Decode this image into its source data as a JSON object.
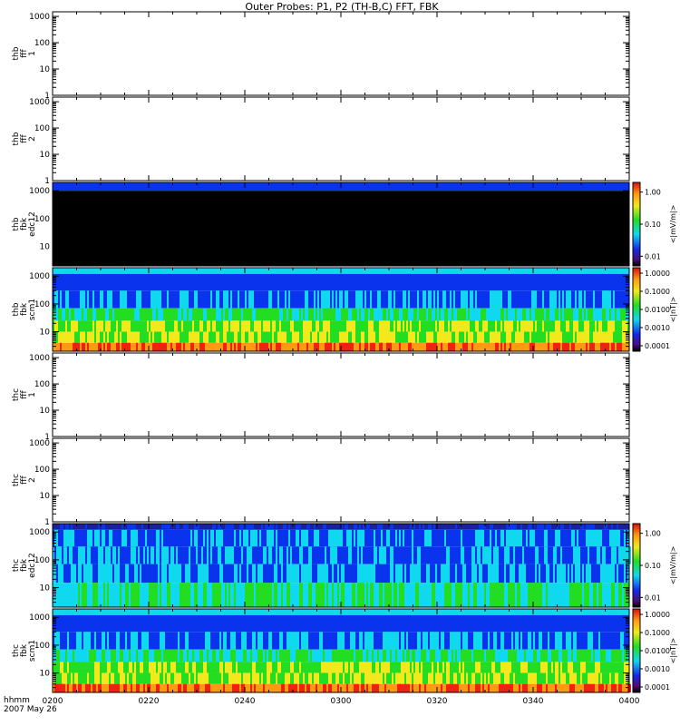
{
  "title": "Outer Probes: P1, P2 (TH-B,C) FFT, FBK",
  "colors": {
    "fill_black": "#000000",
    "band_blue": "#0a33ee",
    "band_cyan": "#10d8ee",
    "band_green": "#22dd22",
    "band_yellow": "#f2e81c",
    "band_orange": "#ff9a12",
    "band_red": "#ee2211",
    "band_navy": "#1a1f9e",
    "band_purple": "#6a1a9a"
  },
  "chart_data": [
    {
      "id": "thb_fff_1",
      "type": "heatmap",
      "ylabel": [
        "thb",
        "fff",
        "1"
      ],
      "yscale": "log",
      "ylim": [
        1,
        1500
      ],
      "yticks": [
        "1",
        "10",
        "100",
        "1000"
      ],
      "xlim": [
        "0200",
        "0400"
      ],
      "colorbar": null,
      "data": "empty"
    },
    {
      "id": "thb_fff_2",
      "type": "heatmap",
      "ylabel": [
        "thb",
        "fff",
        "2"
      ],
      "yscale": "log",
      "ylim": [
        1,
        1500
      ],
      "yticks": [
        "1",
        "10",
        "100",
        "1000"
      ],
      "xlim": [
        "0200",
        "0400"
      ],
      "colorbar": null,
      "data": "empty"
    },
    {
      "id": "thb_fbk_edc12",
      "type": "heatmap",
      "ylabel": [
        "thb",
        "fbk",
        "edc12"
      ],
      "yscale": "log",
      "ylim": [
        2,
        2000
      ],
      "yticks": [
        "10",
        "100",
        "1000"
      ],
      "xlim": [
        "0200",
        "0400"
      ],
      "bands": [
        {
          "from": 1000,
          "to": 2000,
          "color": "band_blue"
        },
        {
          "from": 2,
          "to": 1000,
          "color": "fill_black"
        }
      ],
      "colorbar": {
        "label": "<|mV/m|>",
        "scale": "log",
        "range": [
          0.005,
          2
        ],
        "ticks": [
          "1.00",
          "0.10",
          "0.01"
        ]
      }
    },
    {
      "id": "thb_fbk_scm1",
      "type": "heatmap",
      "ylabel": [
        "thb",
        "fbk",
        "scm1"
      ],
      "yscale": "log",
      "ylim": [
        2,
        2000
      ],
      "yticks": [
        "10",
        "100",
        "1000"
      ],
      "xlim": [
        "0200",
        "0400"
      ],
      "bands": [
        {
          "from": 1200,
          "to": 2000,
          "color": "band_cyan"
        },
        {
          "from": 300,
          "to": 1200,
          "color": "band_blue"
        },
        {
          "from": 70,
          "to": 300,
          "color": "band_blue",
          "alt": "band_cyan"
        },
        {
          "from": 25,
          "to": 70,
          "color": "band_green",
          "alt": "band_cyan"
        },
        {
          "from": 10,
          "to": 25,
          "color": "band_green",
          "alt": "band_yellow"
        },
        {
          "from": 4,
          "to": 10,
          "color": "band_yellow",
          "alt": "band_green"
        },
        {
          "from": 2,
          "to": 4,
          "color": "band_orange",
          "alt": "band_red"
        }
      ],
      "colorbar": {
        "label": "<|nT|>",
        "scale": "log",
        "range": [
          5e-05,
          2
        ],
        "ticks": [
          "1.0000",
          "0.1000",
          "0.0100",
          "0.0010",
          "0.0001"
        ]
      }
    },
    {
      "id": "thc_fff_1",
      "type": "heatmap",
      "ylabel": [
        "thc",
        "fff",
        "1"
      ],
      "yscale": "log",
      "ylim": [
        1,
        1500
      ],
      "yticks": [
        "1",
        "10",
        "100",
        "1000"
      ],
      "xlim": [
        "0200",
        "0400"
      ],
      "colorbar": null,
      "data": "empty"
    },
    {
      "id": "thc_fff_2",
      "type": "heatmap",
      "ylabel": [
        "thc",
        "fff",
        "2"
      ],
      "yscale": "log",
      "ylim": [
        1,
        1500
      ],
      "yticks": [
        "1",
        "10",
        "100",
        "1000"
      ],
      "xlim": [
        "0200",
        "0400"
      ],
      "colorbar": null,
      "data": "empty"
    },
    {
      "id": "thc_fbk_edc12",
      "type": "heatmap",
      "ylabel": [
        "thc",
        "fbk",
        "edc12"
      ],
      "yscale": "log",
      "ylim": [
        2,
        2000
      ],
      "yticks": [
        "10",
        "100",
        "1000"
      ],
      "xlim": [
        "0200",
        "0400"
      ],
      "bands": [
        {
          "from": 1200,
          "to": 2000,
          "color": "band_navy",
          "alt": "band_blue"
        },
        {
          "from": 300,
          "to": 1200,
          "color": "band_blue",
          "alt": "band_cyan"
        },
        {
          "from": 70,
          "to": 300,
          "color": "band_blue",
          "alt": "band_cyan"
        },
        {
          "from": 15,
          "to": 70,
          "color": "band_cyan",
          "alt": "band_blue"
        },
        {
          "from": 2,
          "to": 15,
          "color": "band_cyan",
          "alt": "band_green"
        }
      ],
      "colorbar": {
        "label": "<|mV/m|>",
        "scale": "log",
        "range": [
          0.005,
          2
        ],
        "ticks": [
          "1.00",
          "0.10",
          "0.01"
        ]
      }
    },
    {
      "id": "thc_fbk_scm1",
      "type": "heatmap",
      "ylabel": [
        "thc",
        "fbk",
        "scm1"
      ],
      "yscale": "log",
      "ylim": [
        2,
        2000
      ],
      "yticks": [
        "10",
        "100",
        "1000"
      ],
      "xlim": [
        "0200",
        "0400"
      ],
      "bands": [
        {
          "from": 1200,
          "to": 2000,
          "color": "band_cyan"
        },
        {
          "from": 300,
          "to": 1200,
          "color": "band_blue"
        },
        {
          "from": 70,
          "to": 300,
          "color": "band_blue",
          "alt": "band_cyan"
        },
        {
          "from": 25,
          "to": 70,
          "color": "band_green",
          "alt": "band_cyan"
        },
        {
          "from": 10,
          "to": 25,
          "color": "band_green",
          "alt": "band_yellow"
        },
        {
          "from": 4,
          "to": 10,
          "color": "band_yellow",
          "alt": "band_green"
        },
        {
          "from": 2,
          "to": 4,
          "color": "band_orange",
          "alt": "band_red"
        }
      ],
      "colorbar": {
        "label": "<|nT|>",
        "scale": "log",
        "range": [
          5e-05,
          2
        ],
        "ticks": [
          "1.0000",
          "0.1000",
          "0.0100",
          "0.0010",
          "0.0001"
        ]
      }
    }
  ],
  "x_axis": {
    "label_top": "hhmm",
    "label_bottom": "2007 May 26",
    "ticks": [
      "0200",
      "0220",
      "0240",
      "0300",
      "0320",
      "0340",
      "0400"
    ]
  }
}
